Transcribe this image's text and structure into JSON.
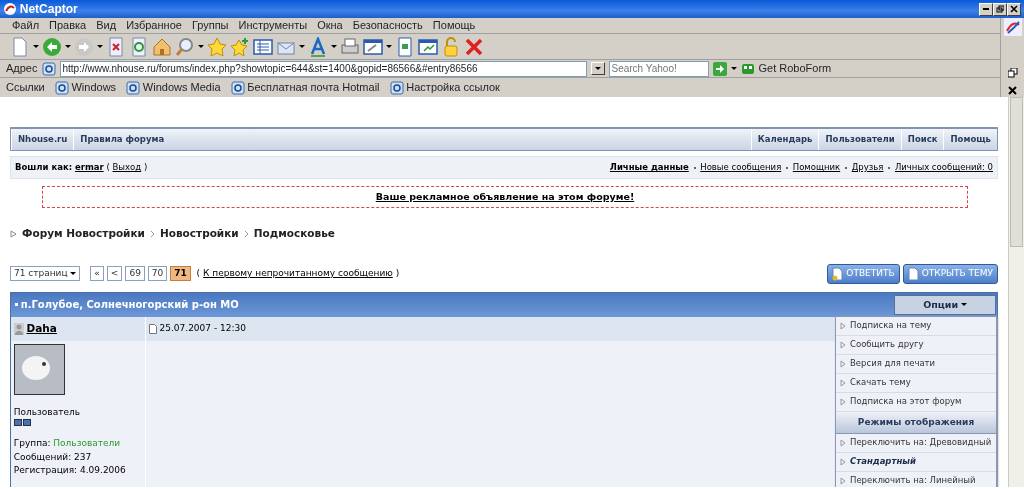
{
  "window": {
    "title": "NetCaptor"
  },
  "menu": [
    "Файл",
    "Правка",
    "Вид",
    "Избранное",
    "Группы",
    "Инструменты",
    "Окна",
    "Безопасность",
    "Помощь"
  ],
  "address_bar": {
    "label": "Адрес",
    "url": "http://www.nhouse.ru/forums/index.php?showtopic=644&st=1400&gopid=86566&#entry86566",
    "search_placeholder": "Search Yahoo!",
    "roboform": "Get RoboForm"
  },
  "links_bar": {
    "label": "Ссылки",
    "items": [
      "Windows",
      "Windows Media",
      "Бесплатная почта Hotmail",
      "Настройка ссылок"
    ]
  },
  "forum_nav": {
    "left": [
      "Nhouse.ru",
      "Правила форума"
    ],
    "right": [
      "Календарь",
      "Пользователи",
      "Поиск",
      "Помощь"
    ]
  },
  "user_bar": {
    "label": "Вошли как:",
    "user": "ermar",
    "open": "(",
    "logout": "Выход",
    "close": ")",
    "links": [
      {
        "text": "Личные данные",
        "bold": true
      },
      {
        "text": "Новые сообщения",
        "bold": false
      },
      {
        "text": "Помощник",
        "bold": false
      },
      {
        "text": "Друзья",
        "bold": false
      },
      {
        "text": "Личных сообщений: 0",
        "bold": false
      }
    ]
  },
  "ad": "Ваше рекламное объявление на этом форуме!",
  "breadcrumb": [
    "Форум Новостройки",
    "Новостройки",
    "Подмосковье"
  ],
  "pagination": {
    "select": "71 страниц",
    "pages": [
      {
        "label": "«",
        "selected": false
      },
      {
        "label": "<",
        "selected": false
      },
      {
        "label": "69",
        "selected": false
      },
      {
        "label": "70",
        "selected": false
      },
      {
        "label": "71",
        "selected": true
      }
    ],
    "open": "(",
    "unread_link": "К первому непрочитанному сообщению",
    "close": ")"
  },
  "actions": [
    "ОТВЕТИТЬ",
    "ОТКРЫТЬ ТЕМУ"
  ],
  "topic": {
    "title": "п.Голубое, Солнечногорский р-он МО",
    "options": "Опции"
  },
  "post": {
    "author": "Daha",
    "date": "25.07.2007 - 12:30",
    "role": "Пользователь",
    "group_label": "Группа:",
    "group": "Пользователи",
    "posts": "Сообщений: 237",
    "registered": "Регистрация: 4.09.2006"
  },
  "options_menu": [
    {
      "kind": "item",
      "label": "Подписка на тему",
      "selected": false
    },
    {
      "kind": "item",
      "label": "Сообщить другу",
      "selected": false
    },
    {
      "kind": "item",
      "label": "Версия для печати",
      "selected": false
    },
    {
      "kind": "item",
      "label": "Скачать тему",
      "selected": false
    },
    {
      "kind": "item",
      "label": "Подписка на этот форум",
      "selected": false
    },
    {
      "kind": "header",
      "label": "Режимы отображения"
    },
    {
      "kind": "item",
      "label": "Переключить на: Древовидный",
      "selected": false
    },
    {
      "kind": "item",
      "label": "Стандартный",
      "selected": true
    },
    {
      "kind": "item",
      "label": "Переключить на: Линейный",
      "selected": false
    }
  ]
}
